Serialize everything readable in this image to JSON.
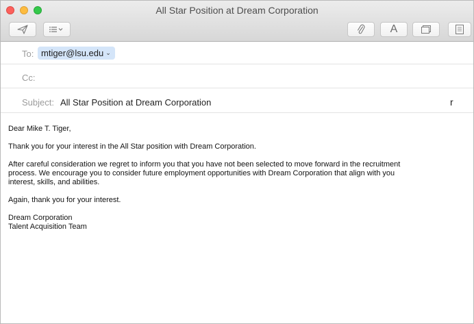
{
  "window": {
    "title": "All Star Position at Dream Corporation"
  },
  "toolbar": {
    "send_icon": "paper-plane-icon",
    "headers_icon": "list-icon",
    "attach_icon": "paperclip-icon",
    "format_label": "A",
    "photo_icon": "photo-browser-icon",
    "stationery_icon": "stationery-icon"
  },
  "header": {
    "to_label": "To:",
    "to_recipient": "mtiger@lsu.edu",
    "cc_label": "Cc:",
    "subject_label": "Subject:",
    "subject_value": "All Star Position at Dream Corporation",
    "subject_trailing": "r"
  },
  "body": {
    "greeting": "Dear Mike T. Tiger,",
    "para1": "Thank you for your interest in the All Star position with Dream Corporation.",
    "para2_line1": "After careful consideration we regret to inform you that you have not been selected to move forward in the recruitment",
    "para2_line2": "process. We encourage you to consider future employment opportunities with Dream Corporation that align with you",
    "para2_line3": "interest, skills, and abilities.",
    "para3": "Again, thank you for your interest.",
    "signature_line1": "Dream Corporation",
    "signature_line2": "Talent Acquisition Team"
  }
}
